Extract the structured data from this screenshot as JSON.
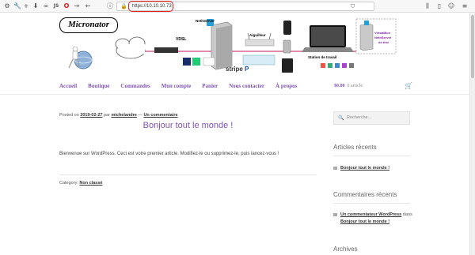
{
  "browser": {
    "url": "https://10.10.10.73",
    "lock_icon": "lock-icon",
    "toolbar_icons": [
      "settings-icon",
      "wrench-icon",
      "plus-icon",
      "download-icon",
      "glasses-icon",
      "js-icon",
      "opera-icon",
      "forward-icon",
      "back-icon",
      "info-icon"
    ],
    "toolbar_icon_glyphs": [
      "⚙",
      "🔧",
      "+",
      "⬇",
      "∞",
      "JS",
      "O",
      "→",
      "←",
      "ⓘ"
    ],
    "right_icons": [
      "bookmarks-icon",
      "sidebar-icon",
      "reader-icon",
      "menu-icon"
    ],
    "right_icon_glyphs": [
      "⫼",
      "▯",
      "☺",
      "≡"
    ]
  },
  "header": {
    "logo": "Micronator",
    "diagram": {
      "nethserver_top": "NethServer",
      "vdsl": "VDSL",
      "aiguilleur": "Aiguilleur",
      "station": "Station de travail",
      "virtualbox": "VirtualBox",
      "nethserver_test": "NethServer",
      "de_test": "de test",
      "stripe": "stripe",
      "lets_encrypt": "Let's Encrypt",
      "paypal": "P",
      "woo": "Woo"
    }
  },
  "nav": {
    "items": [
      "Accueil",
      "Boutique",
      "Commandes",
      "Mon compte",
      "Panier",
      "Nous contacter",
      "À propos"
    ],
    "cart_amount": "$0.00",
    "cart_count": "0 article"
  },
  "post": {
    "meta_prefix": "Posted on",
    "date": "2019-02-27",
    "meta_by": "par",
    "author": "michelandre",
    "meta_sep": "—",
    "comment_link": "Un commentaire",
    "title": "Bonjour tout le monde !",
    "excerpt": "Bienvenue sur WordPress. Ceci est votre premier article. Modifiez-le ou supprimez-le, puis lancez-vous !",
    "category_label": "Category:",
    "category": "Non classé"
  },
  "sidebar": {
    "search_placeholder": "Recherche...",
    "recent_posts_title": "Articles récents",
    "recent_posts": [
      "Bonjour tout le monde !"
    ],
    "recent_comments_title": "Commentaires récents",
    "recent_comment_author": "Un commentateur WordPress",
    "recent_comment_on": "dans",
    "recent_comment_post": "Bonjour tout le monde !",
    "archives_title": "Archives"
  },
  "colors": {
    "accent": "#7f54b3",
    "url_highlight": "#e4201c"
  }
}
